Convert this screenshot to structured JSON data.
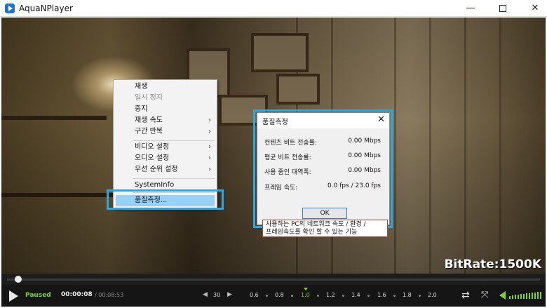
{
  "window": {
    "title": "AquaNPlayer",
    "minimize_symbol": "—",
    "close_symbol": "✕"
  },
  "video": {
    "bitrate": "BitRate:1500K"
  },
  "context_menu": {
    "items": [
      {
        "label": "재생",
        "disabled": false,
        "submenu": false
      },
      {
        "label": "일시 정지",
        "disabled": true,
        "submenu": false
      },
      {
        "label": "중지",
        "disabled": false,
        "submenu": false
      },
      {
        "label": "재생 속도",
        "disabled": false,
        "submenu": true
      },
      {
        "label": "구간 반복",
        "disabled": false,
        "submenu": true
      },
      {
        "label": "비디오 설정",
        "disabled": false,
        "submenu": true
      },
      {
        "label": "오디오 설정",
        "disabled": false,
        "submenu": true
      },
      {
        "label": "우선 순위 설정",
        "disabled": false,
        "submenu": true
      },
      {
        "label": "SystemInfo",
        "disabled": false,
        "submenu": false
      },
      {
        "label": "품질측정...",
        "disabled": false,
        "submenu": false
      }
    ],
    "submenu_arrow": "›"
  },
  "quality_dialog": {
    "title": "품질측정",
    "close_symbol": "✕",
    "rows": [
      {
        "label": "컨텐츠 비트 전송률:",
        "value": "0.00 Mbps"
      },
      {
        "label": "평균 비트 전송률:",
        "value": "0.00 Mbps"
      },
      {
        "label": "사용 중인 대역폭:",
        "value": "0.00 Mbps"
      },
      {
        "label": "프레임 속도:",
        "value": "0.0 fps / 23.0 fps"
      }
    ],
    "ok_label": "OK"
  },
  "tooltip": {
    "line1": "사용하는 PC의 네트워크 속도 / 환경 /",
    "line2": "프레임속도를 확인 할 수 있는 기능"
  },
  "controls": {
    "status": "Paused",
    "current_time": "00:00:08",
    "total_time": "/ 00:08:53",
    "skip_left": "◀",
    "skip_seconds": "30",
    "skip_right": "▶",
    "speeds": [
      "0.6",
      "0.8",
      "1.0",
      "1.2",
      "1.4",
      "1.6",
      "1.8",
      "2.0"
    ],
    "active_speed": "1.0",
    "repeat_symbol": "⇄",
    "fullscreen_symbol": "⤧",
    "accent_color": "#7cd42c"
  }
}
